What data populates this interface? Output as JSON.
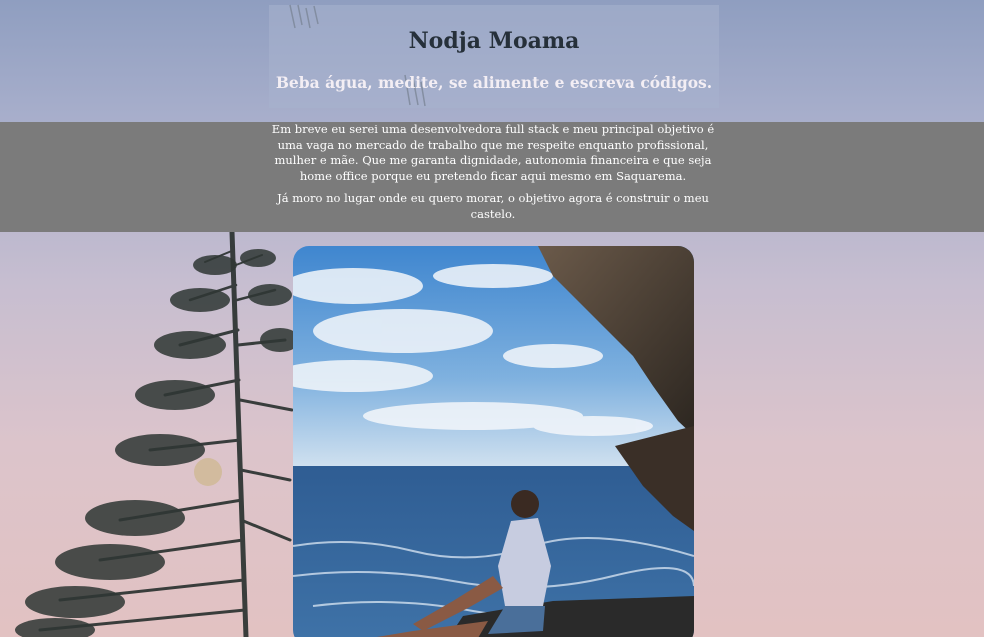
{
  "header": {
    "title": "Nodja Moama",
    "tagline": "Beba água, medite, se alimente e escreva códigos."
  },
  "intro": {
    "paragraphs": [
      "Em breve eu serei uma desenvolvedora full stack e meu principal objetivo é uma vaga no mercado de trabalho que me respeite enquanto profissional, mulher e mãe. Que me garanta dignidade, autonomia financeira e que seja home office porque eu pretendo ficar aqui mesmo em Saquarema.",
      "Já moro no lugar onde eu quero morar, o objetivo agora é construir o meu castelo."
    ]
  },
  "colors": {
    "band": "#7b7b7b",
    "title": "#26303a",
    "tagline": "#f3eef4",
    "sky": "#8f9ec0",
    "sunset": "#e2c2c2"
  }
}
